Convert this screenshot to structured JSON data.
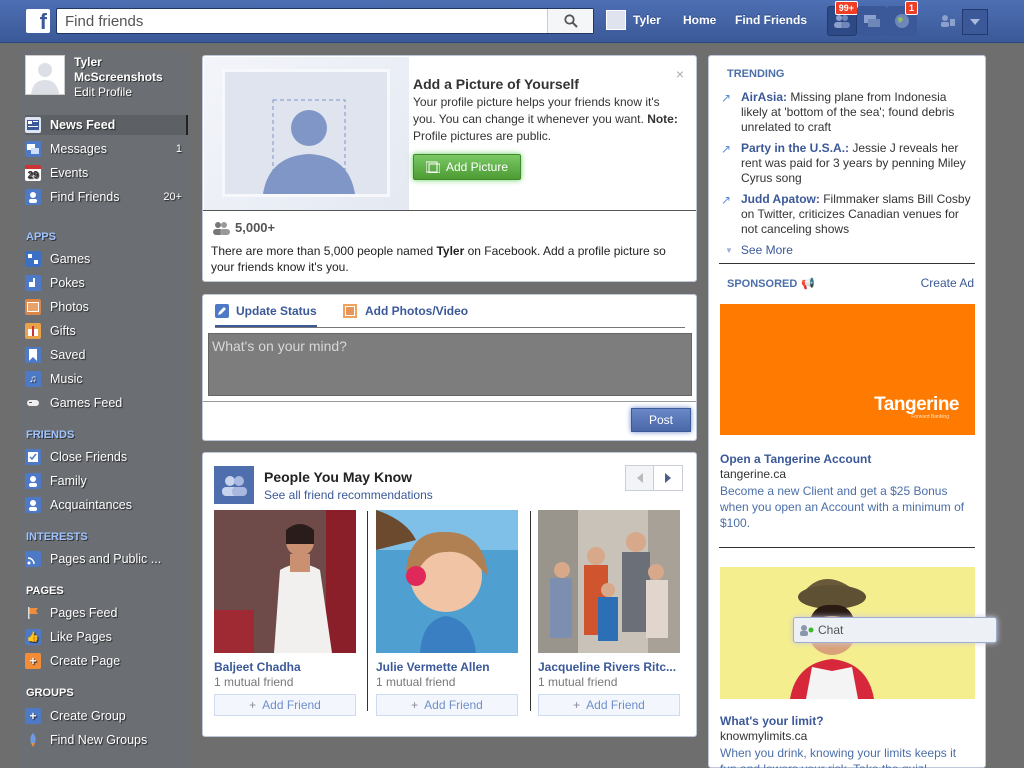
{
  "topbar": {
    "logo": "f",
    "search_placeholder": "Find friends",
    "user_name": "Tyler",
    "home": "Home",
    "find_friends": "Find Friends",
    "friend_requests_badge": "99+",
    "notifications_badge": "1"
  },
  "profile": {
    "name": "Tyler McScreenshots",
    "edit": "Edit Profile"
  },
  "nav": {
    "news_feed": "News Feed",
    "messages": "Messages",
    "messages_count": "1",
    "events": "Events",
    "events_date": "29",
    "find_friends": "Find Friends",
    "find_friends_count": "20+",
    "apps_header": "APPS",
    "games": "Games",
    "pokes": "Pokes",
    "photos": "Photos",
    "gifts": "Gifts",
    "saved": "Saved",
    "music": "Music",
    "games_feed": "Games Feed",
    "friends_header": "FRIENDS",
    "close_friends": "Close Friends",
    "family": "Family",
    "acquaintances": "Acquaintances",
    "interests_header": "INTERESTS",
    "pages_public": "Pages and Public ...",
    "pages_header": "PAGES",
    "pages_feed": "Pages Feed",
    "like_pages": "Like Pages",
    "create_page": "Create Page",
    "groups_header": "GROUPS",
    "create_group": "Create Group",
    "find_new_groups": "Find New Groups"
  },
  "addpic": {
    "title": "Add a Picture of Yourself",
    "text": "Your profile picture helps your friends know it's you. You can change it whenever you want.",
    "note_label": "Note:",
    "note_text": " Profile pictures are public.",
    "button": "Add Picture",
    "close": "×",
    "count": "5,000+",
    "desc_pre": "There are more than 5,000 people named ",
    "desc_name": "Tyler",
    "desc_post": " on Facebook. Add a profile picture so your friends know it's you."
  },
  "composer": {
    "update_status": "Update Status",
    "add_photos": "Add Photos/Video",
    "placeholder": "What's on your mind?",
    "post": "Post"
  },
  "pymk": {
    "title": "People You May Know",
    "subtitle": "See all friend recommendations",
    "people": [
      {
        "name": "Baljeet Chadha",
        "mutual": "1 mutual friend",
        "button": "Add Friend"
      },
      {
        "name": "Julie Vermette Allen",
        "mutual": "1 mutual friend",
        "button": "Add Friend"
      },
      {
        "name": "Jacqueline Rivers Ritc...",
        "mutual": "1 mutual friend",
        "button": "Add Friend"
      }
    ]
  },
  "trending": {
    "header": "TRENDING",
    "items": [
      {
        "topic": "AirAsia:",
        "text": " Missing plane from Indonesia likely at 'bottom of the sea'; found debris unrelated to craft"
      },
      {
        "topic": "Party in the U.S.A.:",
        "text": " Jessie J reveals her rent was paid for 3 years by penning Miley Cyrus song"
      },
      {
        "topic": "Judd Apatow:",
        "text": " Filmmaker slams Bill Cosby on Twitter, criticizes Canadian venues for not canceling shows"
      }
    ],
    "see_more": "See More"
  },
  "sponsored": {
    "header": "SPONSORED",
    "create_ad": "Create Ad",
    "ad1_logo": "Tangerine",
    "ad1_tagline": "Forward Banking",
    "ad1_title": "Open a Tangerine Account",
    "ad1_domain": "tangerine.ca",
    "ad1_text": "Become a new Client and get a $25 Bonus when you open an Account with a minimum of $100.",
    "ad2_title": "What's your limit?",
    "ad2_domain": "knowmylimits.ca",
    "ad2_text": "When you drink, knowing your limits keeps it fun and lowers your risk. Take the quiz!"
  },
  "chat": {
    "label": "Chat"
  }
}
